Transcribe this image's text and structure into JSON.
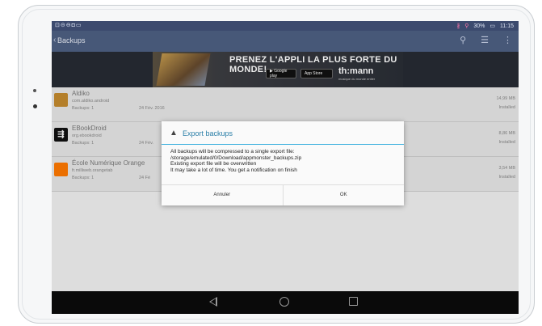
{
  "status_bar": {
    "left_icons": "⊡⊝⊖◘▭",
    "signal": "∦",
    "wifi": "⚲",
    "battery": "30%",
    "time": "11:15"
  },
  "action_bar": {
    "title": "Backups",
    "back": "‹",
    "icons": [
      "search-icon",
      "sort-icon",
      "overflow-menu-icon"
    ]
  },
  "banner": {
    "headline": "PRENEZ L'APPLI LA PLUS FORTE DU MONDE!",
    "badge_google": "▶ Google play",
    "badge_apple": " App Store",
    "brand": "th:mann",
    "brand_sub": "musique du monde entier"
  },
  "apps": [
    {
      "name": "Aldiko",
      "package": "com.aldiko.android",
      "backups": "Backups: 1",
      "date": "24 Fév. 2016",
      "size": "14,99 MB",
      "status": "Installed"
    },
    {
      "name": "EBookDroid",
      "package": "org.ebookdroid",
      "backups": "Backups: 1",
      "date": "24 Fév.",
      "size": "8,86 MB",
      "status": "Installed"
    },
    {
      "name": "École Numérique Orange",
      "package": "fr.milliweb.orangetab",
      "backups": "Backups: 1",
      "date": "24 Fé",
      "size": "3,54 MB",
      "status": "Installed"
    }
  ],
  "dialog": {
    "title": "Export backups",
    "lines": [
      "All backups will be compressed to a single export file:",
      "/storage/emulated/0/Download/appmonster_backups.zip",
      "Existing export file will be overwritten",
      "It may take a lot of time. You get a notification on finish"
    ],
    "cancel_label": "Annuler",
    "ok_label": "OK"
  },
  "colors": {
    "accent": "#45b4e0",
    "title_accent": "#2b7fa8",
    "action_bar": "#4e6083",
    "status_bar": "#3c4a6e"
  }
}
